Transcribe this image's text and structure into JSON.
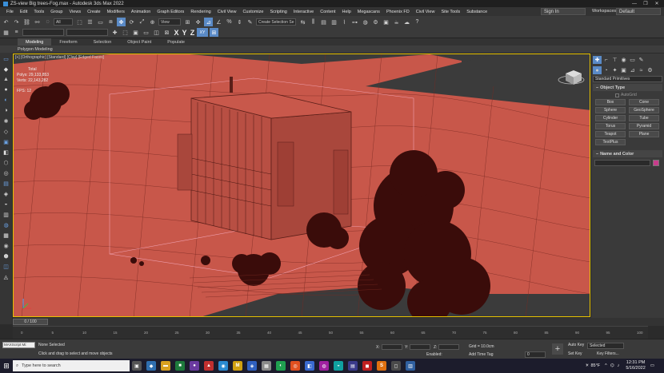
{
  "window": {
    "title": "ZS-view Big trees-Fog.max - Autodesk 3ds Max 2022"
  },
  "menu": {
    "items": [
      "File",
      "Edit",
      "Tools",
      "Group",
      "Views",
      "Create",
      "Modifiers",
      "Animation",
      "Graph Editors",
      "Rendering",
      "Civil View",
      "Customize",
      "Scripting",
      "Interactive",
      "Content",
      "Help",
      "Megascans",
      "Phoenix FD",
      "Civil View",
      "Site Tools",
      "Substance"
    ],
    "signin": "Sign In",
    "workspaces_label": "Workspaces:",
    "workspace": "Default"
  },
  "toolbar": {
    "selection_filter": "All",
    "view_dropdown": "View",
    "named_selection": "Create Selection Se",
    "axis_x": "X",
    "axis_y": "Y",
    "axis_z": "Z",
    "axis_xy": "XY"
  },
  "ribbon": {
    "tabs": [
      "Modeling",
      "Freeform",
      "Selection",
      "Object Paint",
      "Populate"
    ],
    "active_tab": 0,
    "subpanel": "Polygon Modeling"
  },
  "viewport": {
    "label": "[+] [Orthographic] [Standard] [Clay] [Edged Faces]",
    "stats_total": "Total",
    "stats_polys_label": "Polys:",
    "stats_polys": "29,133,853",
    "stats_verts_label": "Verts:",
    "stats_verts": "22,143,282",
    "stats_fps_label": "FPS:",
    "stats_fps": "12"
  },
  "command_panel": {
    "category": "Standard Primitives",
    "object_type_title": "Object Type",
    "autogrid": "AutoGrid",
    "primitives": [
      "Box",
      "Cone",
      "Sphere",
      "GeoSphere",
      "Cylinder",
      "Tube",
      "Torus",
      "Pyramid",
      "Teapot",
      "Plane",
      "TextPlus"
    ],
    "name_color_title": "Name and Color"
  },
  "timeline": {
    "frame_display": "0 / 100",
    "ticks": [
      "0",
      "5",
      "10",
      "15",
      "20",
      "25",
      "30",
      "35",
      "40",
      "45",
      "50",
      "55",
      "60",
      "65",
      "70",
      "75",
      "80",
      "85",
      "90",
      "95",
      "100"
    ]
  },
  "status": {
    "maxscript": "MAXScript Mi:",
    "selection": "None Selected",
    "prompt": "Click and drag to select and move objects",
    "x_label": "X:",
    "y_label": "Y:",
    "z_label": "Z:",
    "grid": "Grid = 10.0cm",
    "enabled": "Enabled:",
    "add_time_tag": "Add Time Tag",
    "auto_key": "Auto Key",
    "set_key": "Set Key",
    "selected": "Selected",
    "key_filters": "Key Filters...",
    "frame": "0"
  },
  "taskbar": {
    "search_placeholder": "Type here to search",
    "temperature": "85°F",
    "time": "12:31 PM",
    "date": "5/16/2022"
  }
}
